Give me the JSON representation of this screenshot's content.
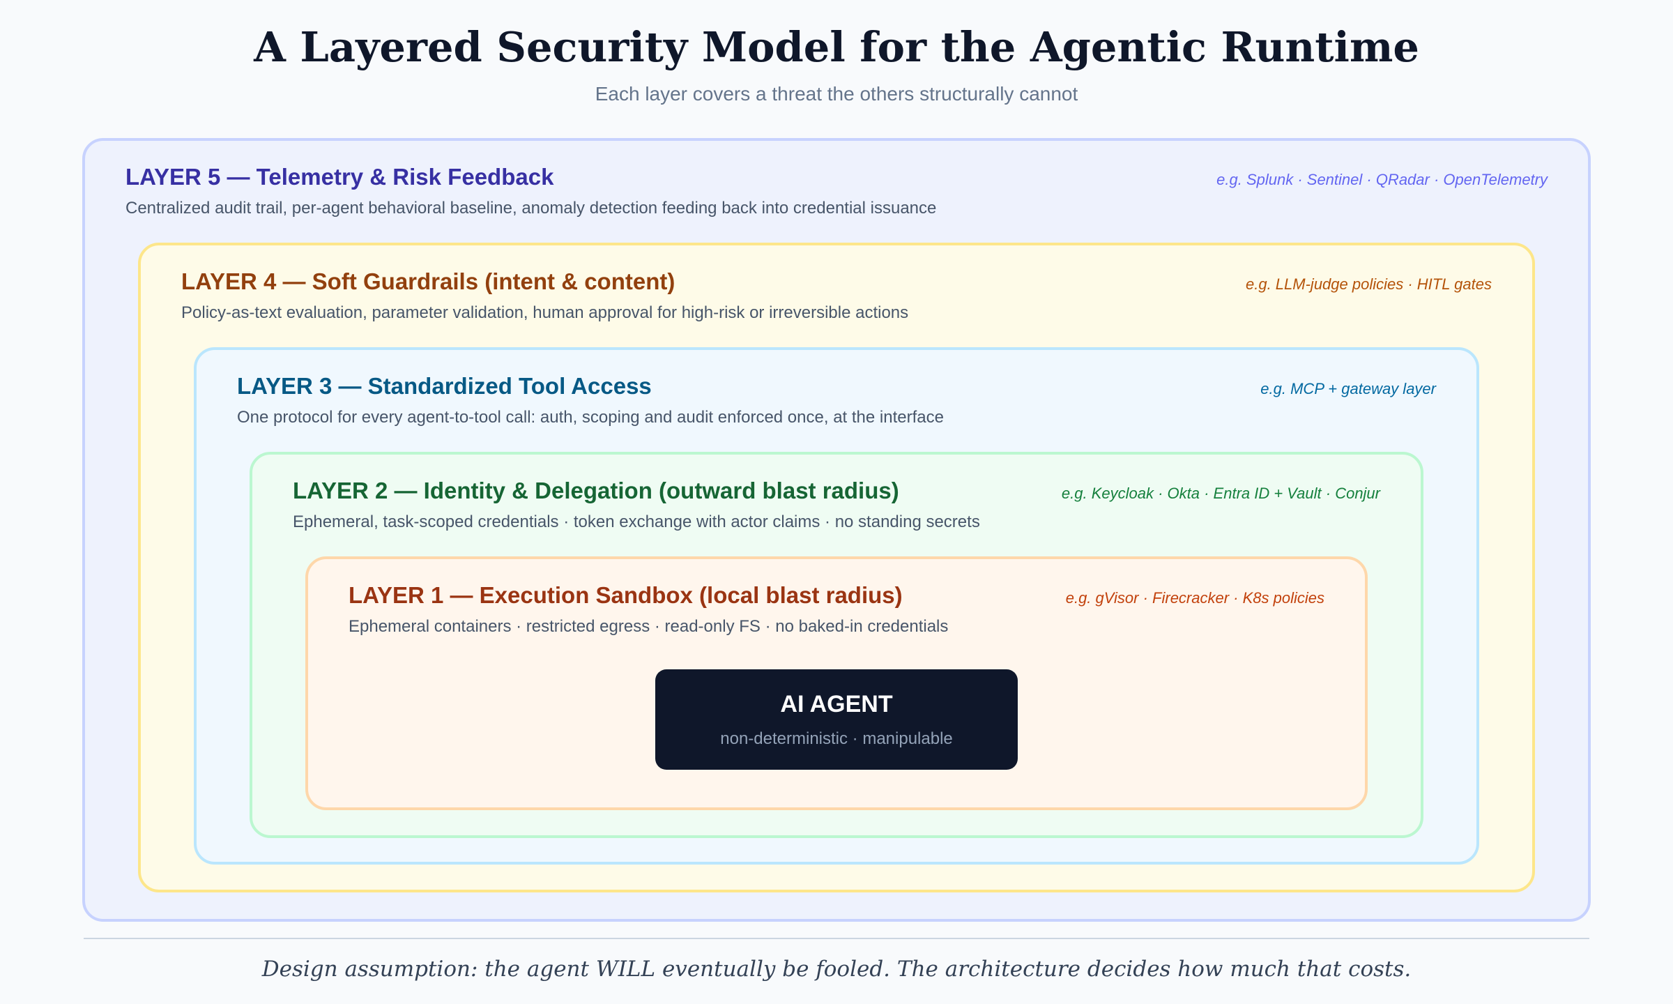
{
  "title": "A Layered Security Model for the Agentic Runtime",
  "subtitle": "Each layer covers a threat the others structurally cannot",
  "layers": [
    {
      "heading": "LAYER 5 — Telemetry & Risk Feedback",
      "description": "Centralized audit trail, per-agent behavioral baseline, anomaly detection feeding back into credential issuance",
      "examples": "e.g. Splunk · Sentinel · QRadar · OpenTelemetry"
    },
    {
      "heading": "LAYER 4 — Soft Guardrails (intent & content)",
      "description": "Policy-as-text evaluation, parameter validation, human approval for high-risk or irreversible actions",
      "examples": "e.g. LLM-judge policies · HITL gates"
    },
    {
      "heading": "LAYER 3 — Standardized Tool Access",
      "description": "One protocol for every agent-to-tool call: auth, scoping and audit enforced once, at the interface",
      "examples": "e.g. MCP + gateway layer"
    },
    {
      "heading": "LAYER 2 — Identity & Delegation (outward blast radius)",
      "description": "Ephemeral, task-scoped credentials · token exchange with actor claims · no standing secrets",
      "examples": "e.g. Keycloak · Okta · Entra ID + Vault · Conjur"
    },
    {
      "heading": "LAYER 1 — Execution Sandbox (local blast radius)",
      "description": "Ephemeral containers · restricted egress · read-only FS · no baked-in credentials",
      "examples": "e.g. gVisor · Firecracker · K8s policies"
    }
  ],
  "agent": {
    "title": "AI AGENT",
    "subtitle": "non-deterministic · manipulable"
  },
  "footer": "Design assumption: the agent WILL eventually be fooled. The architecture decides how much that costs."
}
